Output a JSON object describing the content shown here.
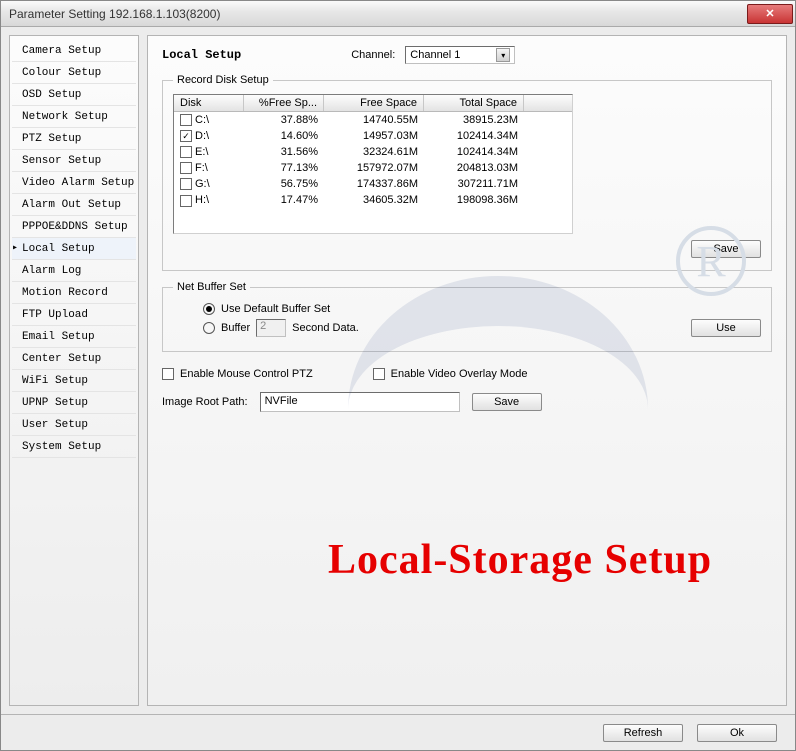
{
  "window": {
    "title": "Parameter Setting 192.168.1.103(8200)"
  },
  "sidebar": {
    "items": [
      {
        "label": "Camera Setup"
      },
      {
        "label": "Colour Setup"
      },
      {
        "label": "OSD Setup"
      },
      {
        "label": "Network Setup"
      },
      {
        "label": "PTZ Setup"
      },
      {
        "label": "Sensor Setup"
      },
      {
        "label": "Video Alarm Setup"
      },
      {
        "label": "Alarm Out Setup"
      },
      {
        "label": "PPPOE&DDNS Setup"
      },
      {
        "label": "Local Setup",
        "selected": true
      },
      {
        "label": "Alarm Log"
      },
      {
        "label": "Motion Record"
      },
      {
        "label": "FTP Upload"
      },
      {
        "label": "Email Setup"
      },
      {
        "label": "Center Setup"
      },
      {
        "label": "WiFi Setup"
      },
      {
        "label": "UPNP Setup"
      },
      {
        "label": "User Setup"
      },
      {
        "label": "System Setup"
      }
    ]
  },
  "main": {
    "heading": "Local Setup",
    "channel_label": "Channel:",
    "channel_selected": "Channel 1"
  },
  "record_disk": {
    "legend": "Record Disk Setup",
    "headers": {
      "disk": "Disk",
      "pct": "%Free Sp...",
      "free": "Free Space",
      "total": "Total Space"
    },
    "rows": [
      {
        "checked": false,
        "disk": "C:\\",
        "pct": "37.88%",
        "free": "14740.55M",
        "total": "38915.23M"
      },
      {
        "checked": true,
        "disk": "D:\\",
        "pct": "14.60%",
        "free": "14957.03M",
        "total": "102414.34M"
      },
      {
        "checked": false,
        "disk": "E:\\",
        "pct": "31.56%",
        "free": "32324.61M",
        "total": "102414.34M"
      },
      {
        "checked": false,
        "disk": "F:\\",
        "pct": "77.13%",
        "free": "157972.07M",
        "total": "204813.03M"
      },
      {
        "checked": false,
        "disk": "G:\\",
        "pct": "56.75%",
        "free": "174337.86M",
        "total": "307211.71M"
      },
      {
        "checked": false,
        "disk": "H:\\",
        "pct": "17.47%",
        "free": "34605.32M",
        "total": "198098.36M"
      }
    ],
    "save_label": "Save"
  },
  "net_buffer": {
    "legend": "Net Buffer Set",
    "opt_default": "Use Default Buffer Set",
    "opt_buffer": "Buffer",
    "buffer_value": "2",
    "second_data": "Second Data.",
    "use_label": "Use"
  },
  "checks": {
    "mouse_ptz": "Enable Mouse Control PTZ",
    "overlay": "Enable Video Overlay Mode"
  },
  "image_path": {
    "label": "Image Root Path:",
    "value": "NVFile",
    "save_label": "Save"
  },
  "caption": "Local-Storage Setup",
  "bottom": {
    "refresh": "Refresh",
    "ok": "Ok"
  }
}
